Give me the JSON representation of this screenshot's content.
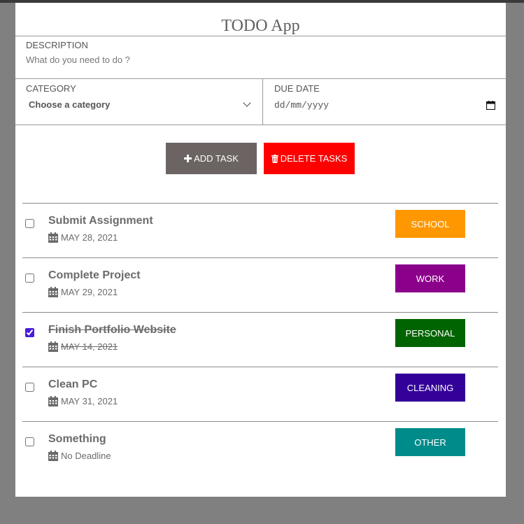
{
  "app": {
    "title": "TODO App"
  },
  "form": {
    "description": {
      "label": "DESCRIPTION",
      "placeholder": "What do you need to do ?"
    },
    "category": {
      "label": "CATEGORY",
      "selected": "Choose a category"
    },
    "due_date": {
      "label": "DUE DATE",
      "placeholder": "dd/mm/yyyy"
    }
  },
  "buttons": {
    "add": "ADD TASK",
    "delete": "DELETE TASKS"
  },
  "colors": {
    "school": "#ff9800",
    "work": "#8b008b",
    "personal": "#006400",
    "cleaning": "#330099",
    "other": "#008b8b",
    "add_button": "#6b6462",
    "delete_button": "#ff0000"
  },
  "tasks": [
    {
      "title": "Submit Assignment",
      "date": "MAY 28, 2021",
      "category": "SCHOOL",
      "checked": false
    },
    {
      "title": "Complete Project",
      "date": "MAY 29, 2021",
      "category": "WORK",
      "checked": false
    },
    {
      "title": "Finish Portfolio Website",
      "date": "MAY 14, 2021",
      "category": "PERSONAL",
      "checked": true
    },
    {
      "title": "Clean PC",
      "date": "MAY 31, 2021",
      "category": "CLEANING",
      "checked": false
    },
    {
      "title": "Something",
      "date": "No Deadline",
      "category": "OTHER",
      "checked": false
    }
  ]
}
